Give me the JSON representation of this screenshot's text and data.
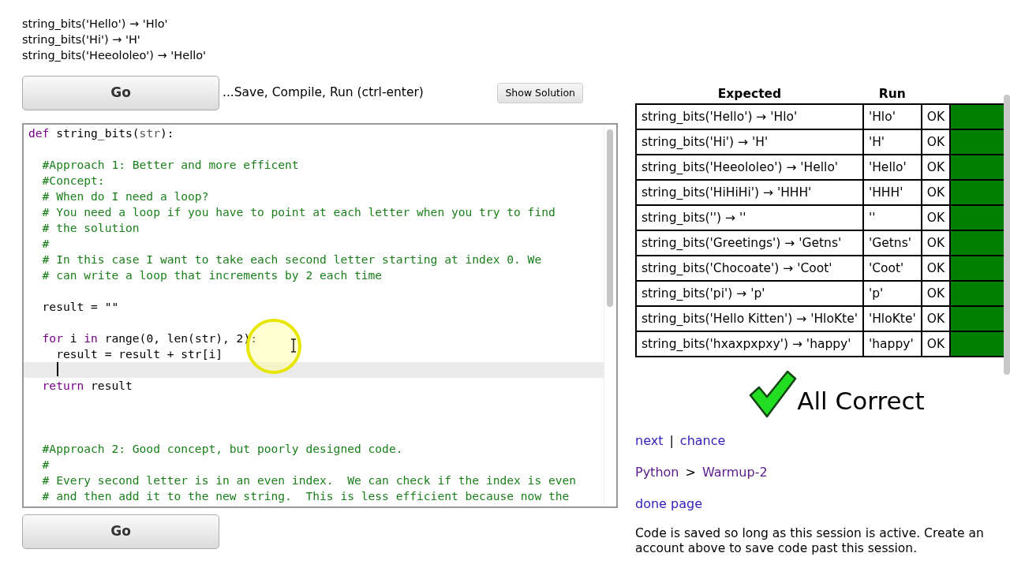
{
  "examples": [
    "string_bits('Hello') → 'Hlo'",
    "string_bits('Hi') → 'H'",
    "string_bits('Heeololeo') → 'Hello'"
  ],
  "toolbar": {
    "go_button": "Go",
    "hint": "...Save, Compile, Run (ctrl-enter)",
    "solution_button": "Show Solution"
  },
  "editor": {
    "lines": [
      {
        "segments": [
          {
            "kind": "keyword",
            "text": "def"
          },
          {
            "kind": "plain",
            "text": " string_bits("
          },
          {
            "kind": "param",
            "text": "str"
          },
          {
            "kind": "plain",
            "text": "):"
          }
        ]
      },
      {
        "kind": "blank"
      },
      {
        "segments": [
          {
            "kind": "comment",
            "text": "  #Approach 1: Better and more efficent"
          }
        ]
      },
      {
        "segments": [
          {
            "kind": "comment",
            "text": "  #Concept:"
          }
        ]
      },
      {
        "segments": [
          {
            "kind": "comment",
            "text": "  # When do I need a loop?"
          }
        ]
      },
      {
        "segments": [
          {
            "kind": "comment",
            "text": "  # You need a loop if you have to point at each letter when you try to find"
          }
        ]
      },
      {
        "segments": [
          {
            "kind": "comment",
            "text": "  # the solution"
          }
        ]
      },
      {
        "segments": [
          {
            "kind": "comment",
            "text": "  #"
          }
        ]
      },
      {
        "segments": [
          {
            "kind": "comment",
            "text": "  # In this case I want to take each second letter starting at index 0. We"
          }
        ]
      },
      {
        "segments": [
          {
            "kind": "comment",
            "text": "  # can write a loop that increments by 2 each time"
          }
        ]
      },
      {
        "kind": "blank"
      },
      {
        "segments": [
          {
            "kind": "plain",
            "text": "  result = \"\""
          }
        ]
      },
      {
        "kind": "blank"
      },
      {
        "segments": [
          {
            "kind": "keyword",
            "text": "  for"
          },
          {
            "kind": "plain",
            "text": " i "
          },
          {
            "kind": "keyword",
            "text": "in"
          },
          {
            "kind": "plain",
            "text": " range(0, len(str), 2):"
          }
        ]
      },
      {
        "segments": [
          {
            "kind": "plain",
            "text": "    result = result + str[i]"
          }
        ]
      },
      {
        "kind": "blank",
        "current": true
      },
      {
        "segments": [
          {
            "kind": "keyword",
            "text": "  return"
          },
          {
            "kind": "plain",
            "text": " result"
          }
        ]
      },
      {
        "kind": "blank"
      },
      {
        "kind": "blank"
      },
      {
        "kind": "blank"
      },
      {
        "segments": [
          {
            "kind": "comment",
            "text": "  #Approach 2: Good concept, but poorly designed code."
          }
        ]
      },
      {
        "segments": [
          {
            "kind": "comment",
            "text": "  #"
          }
        ]
      },
      {
        "segments": [
          {
            "kind": "comment",
            "text": "  # Every second letter is in an even index.  We can check if the index is even"
          }
        ]
      },
      {
        "segments": [
          {
            "kind": "comment",
            "text": "  # and then add it to the new string.  This is less efficient because now the"
          }
        ]
      }
    ]
  },
  "bottom_go_button": "Go",
  "results": {
    "columns": [
      "Expected",
      "Run"
    ],
    "rows": [
      {
        "expected": "string_bits('Hello') → 'Hlo'",
        "run": "'Hlo'",
        "status": "OK",
        "passed": true
      },
      {
        "expected": "string_bits('Hi') → 'H'",
        "run": "'H'",
        "status": "OK",
        "passed": true
      },
      {
        "expected": "string_bits('Heeololeo') → 'Hello'",
        "run": "'Hello'",
        "status": "OK",
        "passed": true
      },
      {
        "expected": "string_bits('HiHiHi') → 'HHH'",
        "run": "'HHH'",
        "status": "OK",
        "passed": true
      },
      {
        "expected": "string_bits('') → ''",
        "run": "''",
        "status": "OK",
        "passed": true
      },
      {
        "expected": "string_bits('Greetings') → 'Getns'",
        "run": "'Getns'",
        "status": "OK",
        "passed": true
      },
      {
        "expected": "string_bits('Chocoate') → 'Coot'",
        "run": "'Coot'",
        "status": "OK",
        "passed": true
      },
      {
        "expected": "string_bits('pi') → 'p'",
        "run": "'p'",
        "status": "OK",
        "passed": true
      },
      {
        "expected": "string_bits('Hello Kitten') → 'HloKte'",
        "run": "'HloKte'",
        "status": "OK",
        "passed": true
      },
      {
        "expected": "string_bits('hxaxpxpxy') → 'happy'",
        "run": "'happy'",
        "status": "OK",
        "passed": true
      }
    ]
  },
  "verdict": "All Correct",
  "nav_links": [
    "next",
    "|",
    "chance"
  ],
  "breadcrumb": [
    "Python",
    ">",
    "Warmup-2"
  ],
  "done_link": "done page",
  "note": "Code is saved so long as this session is active. Create an account above to save code past this session."
}
